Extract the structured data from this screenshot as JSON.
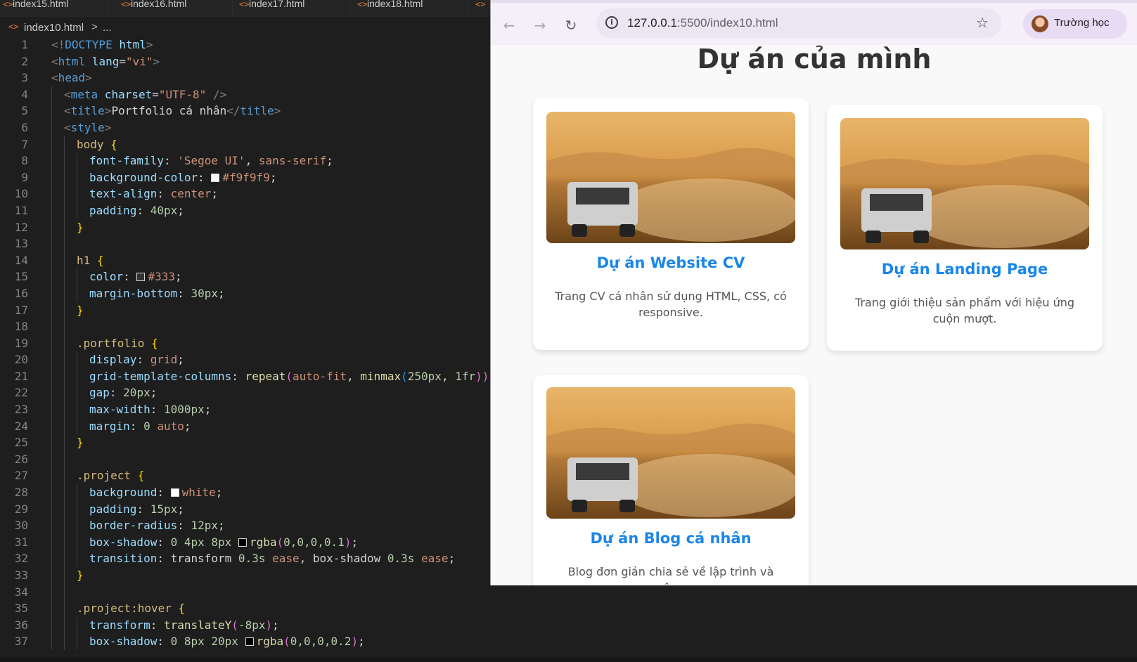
{
  "editor": {
    "tabs": [
      "index15.html",
      "index16.html",
      "index17.html",
      "index18.html"
    ],
    "breadcrumb": {
      "file": "index10.html",
      "separator": ">",
      "more": "..."
    },
    "line_numbers": [
      "1",
      "2",
      "3",
      "4",
      "5",
      "6",
      "7",
      "8",
      "9",
      "10",
      "11",
      "12",
      "13",
      "14",
      "15",
      "16",
      "17",
      "18",
      "19",
      "20",
      "21",
      "22",
      "23",
      "24",
      "25",
      "26",
      "27",
      "28",
      "29",
      "30",
      "31",
      "32",
      "33",
      "34",
      "35",
      "36",
      "37"
    ],
    "code": {
      "l1a": "<!",
      "l1b": "DOCTYPE",
      "l1c": " html",
      "l1d": ">",
      "l2a": "<",
      "l2b": "html",
      "l2c": " lang",
      "l2d": "=",
      "l2e": "\"vi\"",
      "l2f": ">",
      "l3a": "<",
      "l3b": "head",
      "l3c": ">",
      "l4a": "<",
      "l4b": "meta",
      "l4c": " charset",
      "l4d": "=",
      "l4e": "\"UTF-8\"",
      "l4f": " />",
      "l5a": "<",
      "l5b": "title",
      "l5c": ">",
      "l5d": "Portfolio cá nhân",
      "l5e": "</",
      "l5f": "title",
      "l5g": ">",
      "l6a": "<",
      "l6b": "style",
      "l6c": ">",
      "l7a": "body",
      "l7b": " {",
      "l8a": "font-family",
      "l8b": ": ",
      "l8c": "'Segoe UI'",
      "l8d": ", ",
      "l8e": "sans-serif",
      "l8f": ";",
      "l9a": "background-color",
      "l9b": ": ",
      "l9c": "#f9f9f9",
      "l9d": ";",
      "l10a": "text-align",
      "l10b": ": ",
      "l10c": "center",
      "l10d": ";",
      "l11a": "padding",
      "l11b": ": ",
      "l11c": "40px",
      "l11d": ";",
      "l12a": "}",
      "l14a": "h1",
      "l14b": " {",
      "l15a": "color",
      "l15b": ": ",
      "l15c": "#333",
      "l15d": ";",
      "l16a": "margin-bottom",
      "l16b": ": ",
      "l16c": "30px",
      "l16d": ";",
      "l17a": "}",
      "l19a": ".portfolio",
      "l19b": " {",
      "l20a": "display",
      "l20b": ": ",
      "l20c": "grid",
      "l20d": ";",
      "l21a": "grid-template-columns",
      "l21b": ": ",
      "l21c": "repeat",
      "l21d": "(",
      "l21e": "auto-fit",
      "l21f": ", ",
      "l21g": "minmax",
      "l21h": "(",
      "l21i": "250px",
      "l21j": ", ",
      "l21k": "1fr",
      "l21l": "))",
      "l22a": "gap",
      "l22b": ": ",
      "l22c": "20px",
      "l22d": ";",
      "l23a": "max-width",
      "l23b": ": ",
      "l23c": "1000px",
      "l23d": ";",
      "l24a": "margin",
      "l24b": ": ",
      "l24c": "0",
      "l24d": " auto",
      "l24e": ";",
      "l25a": "}",
      "l27a": ".project",
      "l27b": " {",
      "l28a": "background",
      "l28b": ": ",
      "l28c": "white",
      "l28d": ";",
      "l29a": "padding",
      "l29b": ": ",
      "l29c": "15px",
      "l29d": ";",
      "l30a": "border-radius",
      "l30b": ": ",
      "l30c": "12px",
      "l30d": ";",
      "l31a": "box-shadow",
      "l31b": ": ",
      "l31c": "0 4px 8px",
      "l31d": " ",
      "l31e": "rgba",
      "l31f": "(",
      "l31g": "0,0,0,0.1",
      "l31h": ")",
      "l31i": ";",
      "l32a": "transition",
      "l32b": ": ",
      "l32c": "transform ",
      "l32d": "0.3s",
      "l32e": " ease",
      "l32f": ", box-shadow ",
      "l32g": "0.3s",
      "l32h": " ease",
      "l32i": ";",
      "l33a": "}",
      "l35a": ".project:hover",
      "l35b": " {",
      "l36a": "transform",
      "l36b": ": ",
      "l36c": "translateY",
      "l36d": "(",
      "l36e": "-8px",
      "l36f": ")",
      "l36g": ";",
      "l37a": "box-shadow",
      "l37b": ": ",
      "l37c": "0 8px 20px",
      "l37d": " ",
      "l37e": "rgba",
      "l37f": "(",
      "l37g": "0,0,0,0.2",
      "l37h": ")",
      "l37i": ";"
    },
    "swatch_colors": {
      "l9": "#f9f9f9",
      "l15": "#333333",
      "l28": "#ffffff",
      "l31": "#000000",
      "l37": "#000000"
    }
  },
  "browser": {
    "back_icon": "arrow-left-icon",
    "forward_icon": "arrow-right-icon",
    "reload_icon": "reload-icon",
    "url_host": "127.0.0.1",
    "url_path": ":5500/index10.html",
    "profile_name": "Trường học"
  },
  "page": {
    "title": "Dự án của mình",
    "projects": [
      {
        "title": "Dự án Website CV",
        "desc": "Trang CV cá nhân sử dụng HTML, CSS, có responsive."
      },
      {
        "title": "Dự án Landing Page",
        "desc": "Trang giới thiệu sản phẩm với hiệu ứng cuộn mượt."
      },
      {
        "title": "Dự án Blog cá nhân",
        "desc": "Blog đơn giản chia sẻ về lập trình và công"
      }
    ]
  },
  "colors": {
    "editor_bg": "#1e1e1e",
    "accent_link": "#1a86e8",
    "heading": "#333333"
  }
}
